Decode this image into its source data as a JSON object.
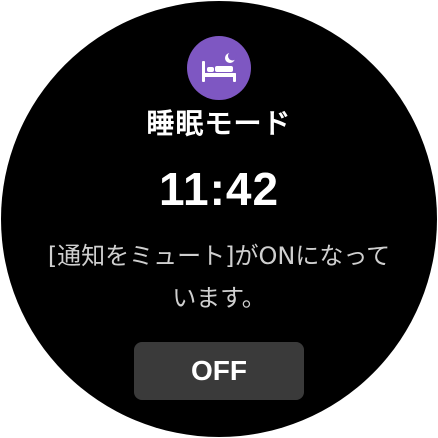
{
  "mode": {
    "icon": "bed-moon-icon",
    "icon_color": "#7e57c2",
    "title": "睡眠モード"
  },
  "clock": {
    "time": "11:42"
  },
  "status": {
    "message": "[通知をミュート]がONになっています。"
  },
  "actions": {
    "off_label": "OFF"
  }
}
